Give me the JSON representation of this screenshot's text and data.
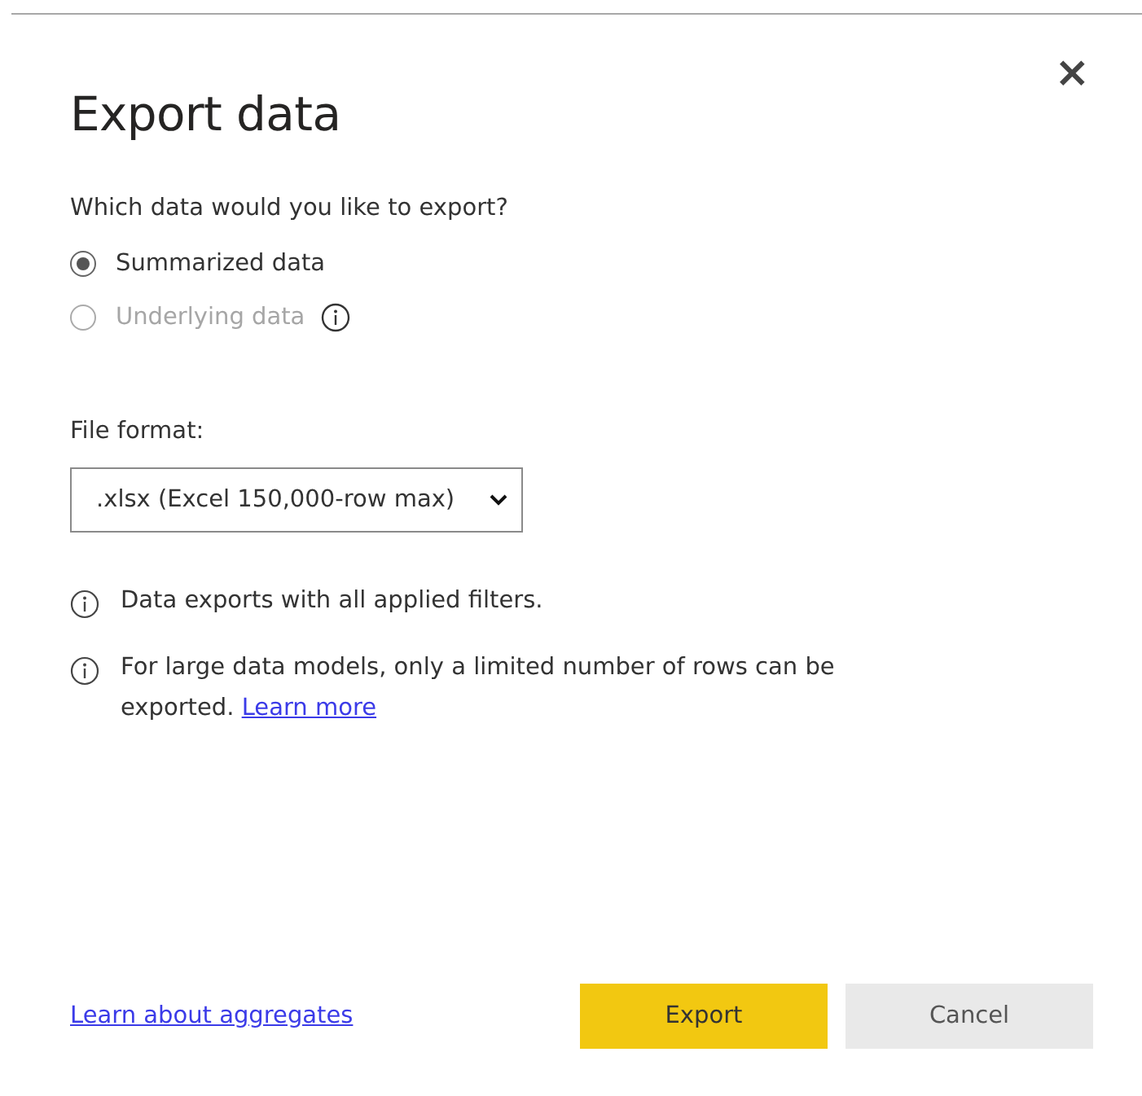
{
  "dialog": {
    "title": "Export data",
    "close": "×"
  },
  "question": "Which data would you like to export?",
  "options": [
    {
      "label": "Summarized data",
      "selected": true,
      "disabled": false,
      "info": false
    },
    {
      "label": "Underlying data",
      "selected": false,
      "disabled": true,
      "info": true
    }
  ],
  "file_format": {
    "label": "File format:",
    "value": ".xlsx (Excel 150,000-row max)"
  },
  "notes": [
    {
      "text": "Data exports with all applied filters."
    },
    {
      "text": "For large data models, only a limited number of rows can be exported.",
      "link": "Learn more"
    }
  ],
  "footer": {
    "link": "Learn about aggregates",
    "buttons": [
      {
        "label": "Export",
        "kind": "primary"
      },
      {
        "label": "Cancel",
        "kind": "secondary"
      }
    ]
  }
}
